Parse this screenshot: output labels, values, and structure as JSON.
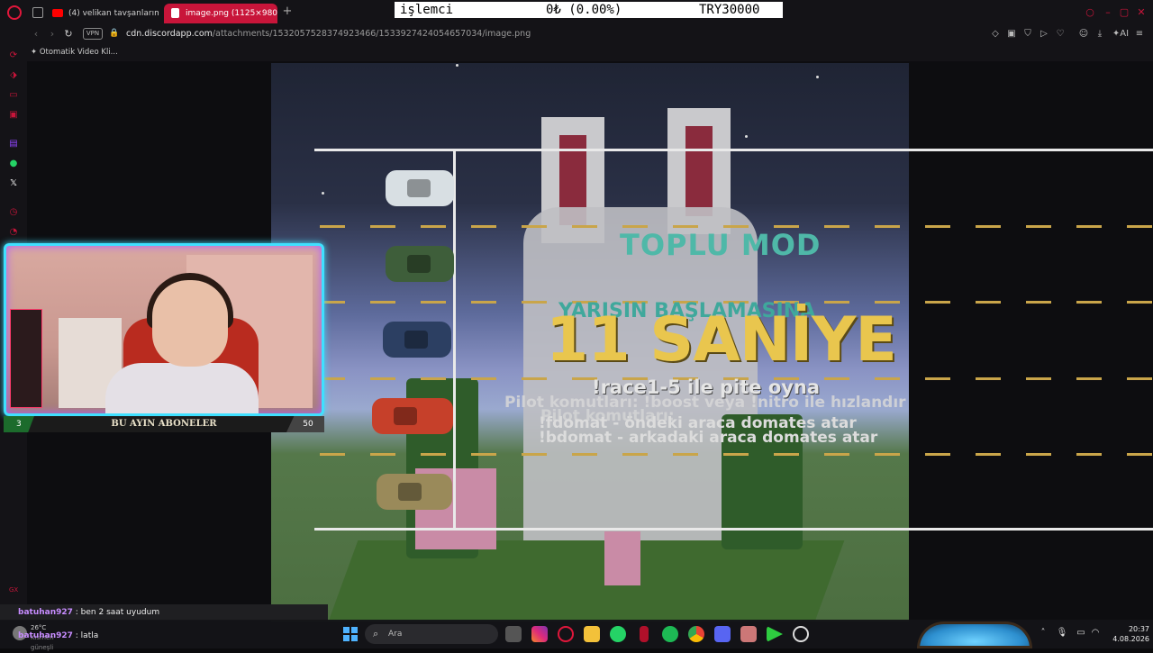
{
  "browser": {
    "tabs": [
      {
        "label": "(4) velikan tavşanlarım...(3)"
      },
      {
        "label": "image.png (1125×980)"
      }
    ],
    "address": {
      "vpn": "VPN",
      "url_domain": "cdn.discordapp.com",
      "url_path": "/attachments/1532057528374923466/1533927424054657034/image.png"
    },
    "bookmark": "Otomatik Video Kli..."
  },
  "ticker": {
    "label": "işlemci",
    "value": "0₺ (0.00%)",
    "goal": "TRY30000"
  },
  "overlay": {
    "mode": "TOPLU MOD",
    "countdown_caption": "YARIŞIN BAŞLAMASINA",
    "countdown": "11 SANİYE",
    "command_race": "!race1-5  ile pite oyna",
    "pilot_info": "Pilot komutları: !boost veya !nitro ile hızlandır",
    "pilot_info2": "Pilot komutları:",
    "fdomat": "!fdomat - öndeki araca domates atar",
    "bdomat": "!bdomat - arkadaki araca domates atar"
  },
  "webcam_bar": {
    "left": "3",
    "title": "BU AYIN ABONELER",
    "right": "50"
  },
  "chat": [
    {
      "user": "batuhan927",
      "text": "ben 2 saat uyudum"
    },
    {
      "user": "batuhan927",
      "text": "latla"
    }
  ],
  "taskbar": {
    "weather_temp": "26°C",
    "weather_desc": "Kısmen güneşli",
    "search_placeholder": "Ara",
    "time": "20:37",
    "date": "4.08.2026"
  },
  "colors": {
    "accent": "#c8153a",
    "webcam_border": "#3fe0ff",
    "countdown": "#e9c64e",
    "mode": "#4fb8a8"
  }
}
